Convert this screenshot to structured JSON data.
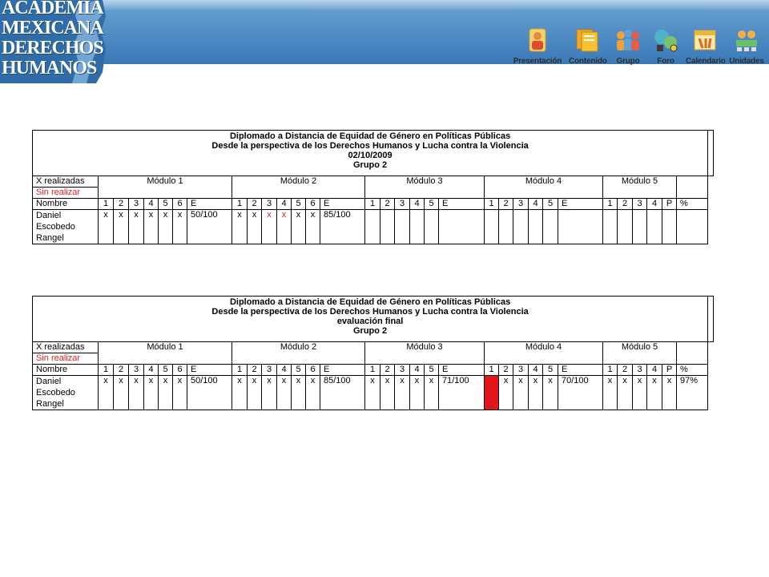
{
  "logo": {
    "title": "ACADEMIA\nMEXICANA\nDERECHOS\nHUMANOS"
  },
  "nav": [
    {
      "label": "Presentación",
      "icon": "presentation-icon"
    },
    {
      "label": "Contenido",
      "icon": "content-icon"
    },
    {
      "label": "Grupo",
      "icon": "group-icon",
      "active": true
    },
    {
      "label": "Foro",
      "icon": "forum-icon"
    },
    {
      "label": "Calendario",
      "icon": "calendar-icon"
    },
    {
      "label": "Unidades",
      "icon": "units-icon"
    }
  ],
  "colors": {
    "header": "#3a79b8",
    "active_nav": "#1d6fb8",
    "pending": "#e02020"
  },
  "tables": [
    {
      "title_lines": [
        "Diplomado a Distancia  de Equidad de Género en Políticas Públicas",
        "Desde la perspectiva  de los Derechos Humanos  y Lucha contra la Violencia",
        "02/10/2009",
        "Grupo 2"
      ],
      "legend_done": "X realizadas",
      "legend_pending": "Sin realizar",
      "modules": [
        "Módulo 1",
        "Módulo 2",
        "Módulo 3",
        "Módulo 4",
        "Módulo 5"
      ],
      "name_header": "Nombre",
      "percent_header": "%",
      "subheaders": [
        [
          "1",
          "2",
          "3",
          "4",
          "5",
          "6",
          "E"
        ],
        [
          "1",
          "2",
          "3",
          "4",
          "5",
          "6",
          "E"
        ],
        [
          "1",
          "2",
          "3",
          "4",
          "5",
          "E"
        ],
        [
          "1",
          "2",
          "3",
          "4",
          "5",
          "E"
        ],
        [
          "1",
          "2",
          "3",
          "4",
          "P"
        ]
      ],
      "student": {
        "name": "Daniel\nEscobedo\nRangel",
        "cells": [
          [
            "x",
            "x",
            "x",
            "x",
            "x",
            "x",
            "50/100"
          ],
          [
            "x",
            "x",
            "x",
            "x",
            "x",
            "x",
            "85/100"
          ],
          [
            "",
            "",
            "",
            "",
            "",
            ""
          ],
          [
            "",
            "",
            "",
            "",
            "",
            ""
          ],
          [
            "",
            "",
            "",
            "",
            ""
          ]
        ],
        "pending_cells": [
          [
            1,
            2
          ],
          [
            1,
            3
          ]
        ],
        "percent": ""
      }
    },
    {
      "title_lines": [
        "Diplomado a Distancia  de Equidad de Género en Políticas Públicas",
        "Desde la perspectiva  de los Derechos Humanos  y Lucha contra la Violencia",
        "evaluación final",
        "Grupo 2"
      ],
      "legend_done": "X realizadas",
      "legend_pending": "Sin realizar",
      "modules": [
        "Módulo 1",
        "Módulo 2",
        "Módulo 3",
        "Módulo 4",
        "Módulo 5"
      ],
      "name_header": "Nombre",
      "percent_header": "%",
      "subheaders": [
        [
          "1",
          "2",
          "3",
          "4",
          "5",
          "6",
          "E"
        ],
        [
          "1",
          "2",
          "3",
          "4",
          "5",
          "6",
          "E"
        ],
        [
          "1",
          "2",
          "3",
          "4",
          "5",
          "E"
        ],
        [
          "1",
          "2",
          "3",
          "4",
          "5",
          "E"
        ],
        [
          "1",
          "2",
          "3",
          "4",
          "P"
        ]
      ],
      "student": {
        "name": "Daniel\nEscobedo\nRangel",
        "cells": [
          [
            "x",
            "x",
            "x",
            "x",
            "x",
            "x",
            "50/100"
          ],
          [
            "x",
            "x",
            "x",
            "x",
            "x",
            "x",
            "85/100"
          ],
          [
            "x",
            "x",
            "x",
            "x",
            "x",
            "71/100"
          ],
          [
            "",
            "x",
            "x",
            "x",
            "x",
            "70/100"
          ],
          [
            "x",
            "x",
            "x",
            "x",
            "x"
          ]
        ],
        "filled_red_cells": [
          [
            3,
            0
          ]
        ],
        "percent": "97%"
      }
    }
  ]
}
